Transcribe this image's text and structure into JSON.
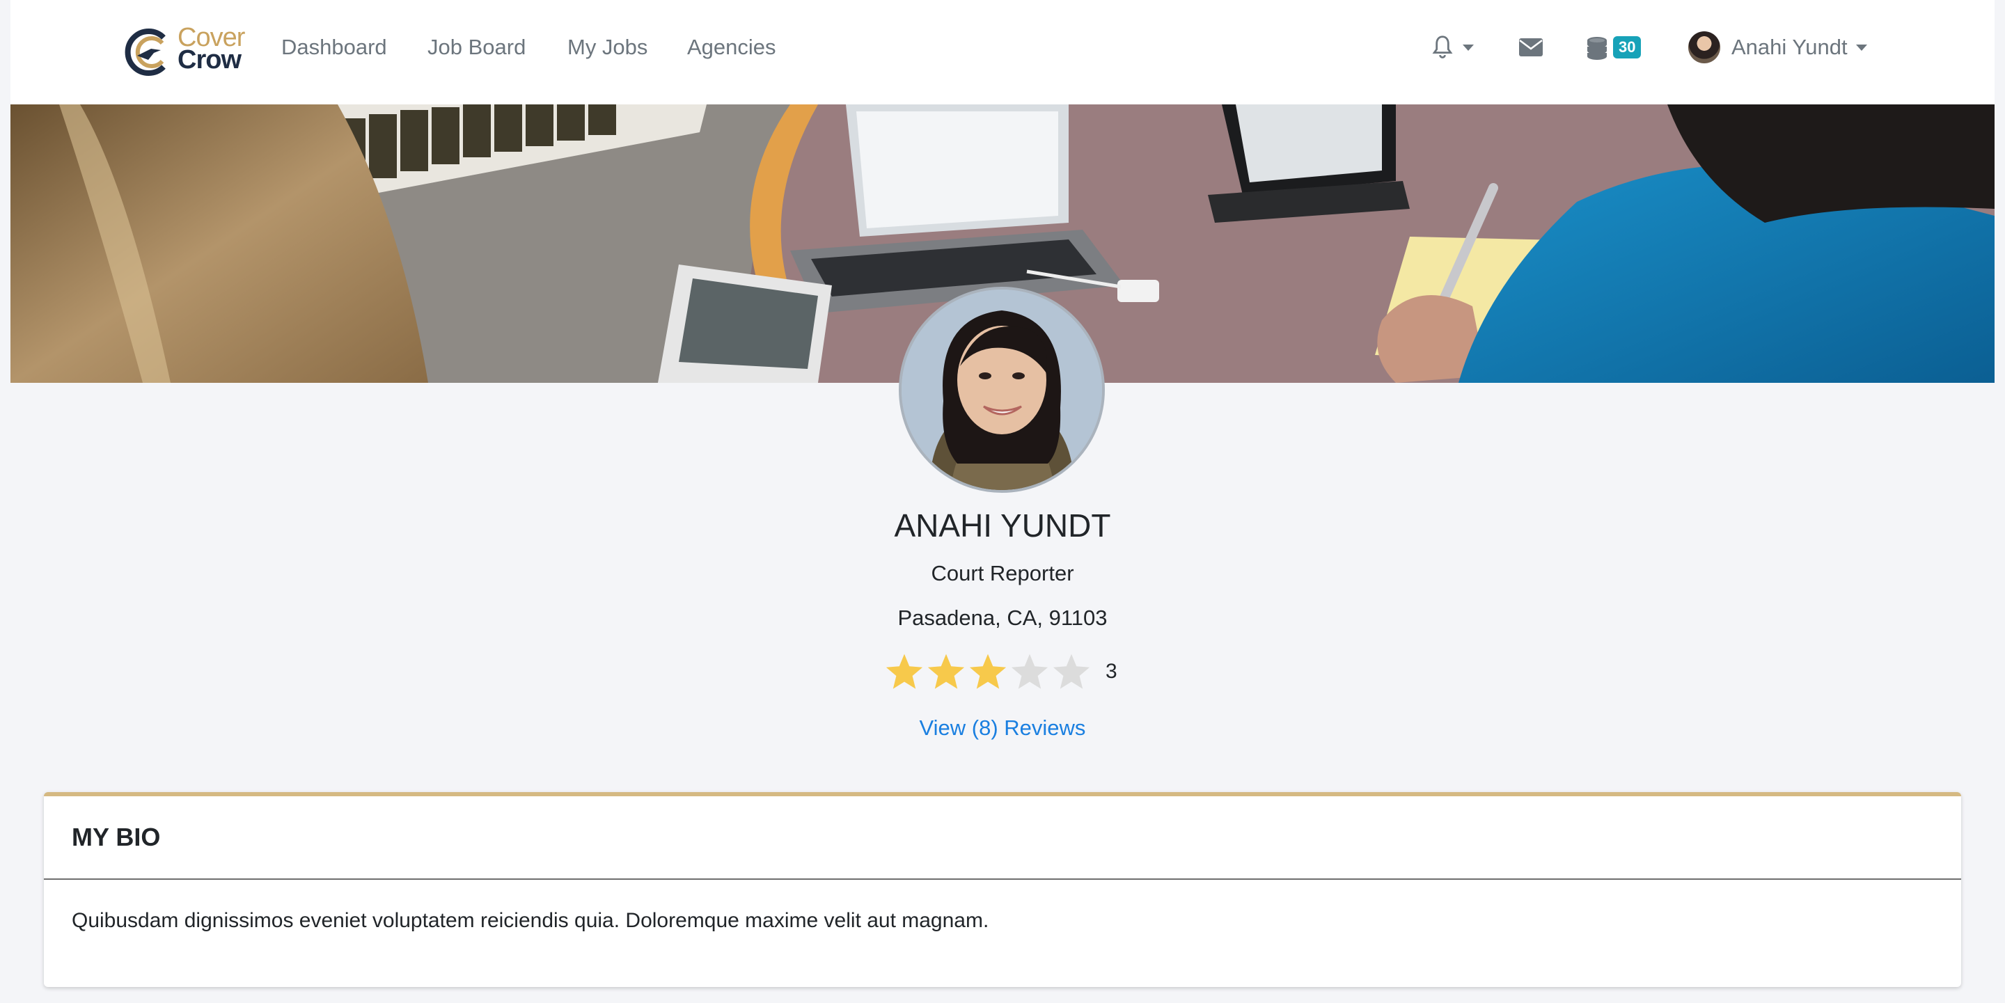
{
  "brand": {
    "line1": "Cover",
    "line2": "Crow",
    "colors": {
      "gold": "#c9a25e",
      "navy": "#1f2d44"
    }
  },
  "nav": {
    "links": [
      {
        "label": "Dashboard"
      },
      {
        "label": "Job Board"
      },
      {
        "label": "My Jobs"
      },
      {
        "label": "Agencies"
      }
    ],
    "icons": [
      "bell-icon",
      "envelope-icon",
      "coins-icon"
    ],
    "credits_badge": "30",
    "user_name": "Anahi Yundt"
  },
  "profile": {
    "name": "ANAHI YUNDT",
    "title": "Court Reporter",
    "location": "Pasadena, CA, 91103",
    "rating": 3,
    "rating_max": 5,
    "rating_label": "3",
    "reviews_link": "View (8) Reviews"
  },
  "bio": {
    "heading": "MY BIO",
    "text": "Quibusdam dignissimos eveniet voluptatem reiciendis quia. Doloremque maxime velit aut magnam."
  },
  "colors": {
    "page_bg": "#f4f5f8",
    "accent_gold": "#d5b982",
    "link_blue": "#1a7fe0",
    "badge_teal": "#17a2b8",
    "star_filled": "#f7c94b",
    "star_empty": "#dcdcdc"
  }
}
